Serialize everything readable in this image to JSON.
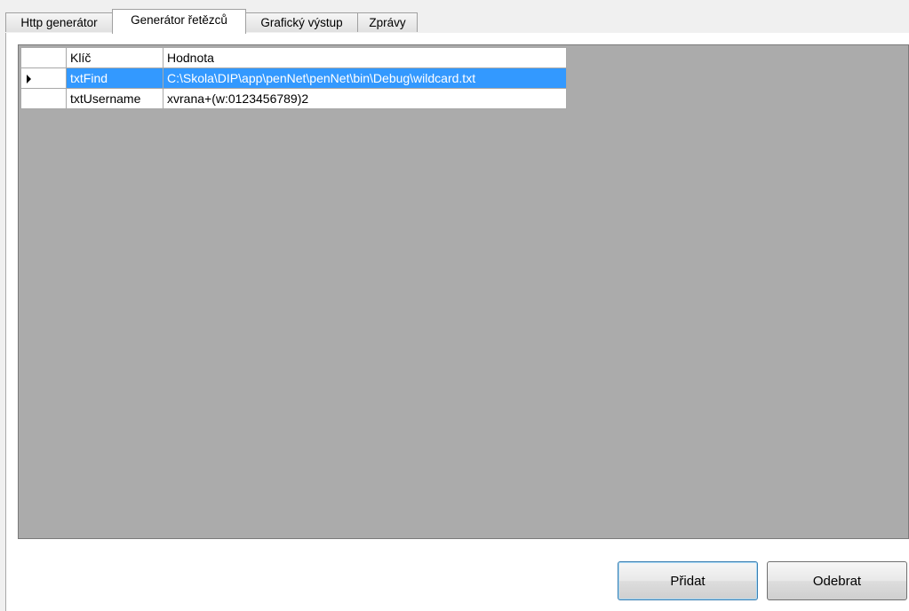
{
  "tabs": [
    {
      "label": "Http generátor",
      "active": false
    },
    {
      "label": "Generátor řetězců",
      "active": true
    },
    {
      "label": "Grafický výstup",
      "active": false
    },
    {
      "label": "Zprávy",
      "active": false
    }
  ],
  "grid": {
    "columns": [
      "Klíč",
      "Hodnota"
    ],
    "rows": [
      {
        "key": "txtFind",
        "value": "C:\\Skola\\DIP\\app\\penNet\\penNet\\bin\\Debug\\wildcard.txt",
        "selected": true,
        "current": true
      },
      {
        "key": "txtUsername",
        "value": "xvrana+(w:0123456789)2",
        "selected": false,
        "current": false
      }
    ]
  },
  "buttons": {
    "add_label": "Přidat",
    "remove_label": "Odebrat"
  },
  "colors": {
    "selection": "#3399ff",
    "grid_background": "#ababab"
  }
}
